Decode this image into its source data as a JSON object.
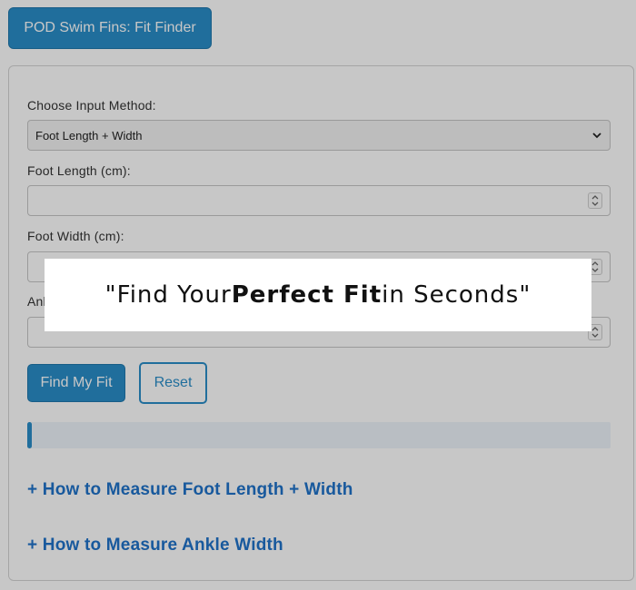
{
  "header": {
    "title": "POD Swim Fins: Fit Finder"
  },
  "form": {
    "method_label": "Choose Input Method:",
    "method_value": "Foot Length + Width",
    "length_label": "Foot Length (cm):",
    "width_label": "Foot Width (cm):",
    "ankle_label_visible": "Ank"
  },
  "buttons": {
    "find": "Find My Fit",
    "reset": "Reset"
  },
  "accordions": [
    "+ How to Measure Foot Length + Width",
    "+ How to Measure Ankle Width"
  ],
  "banner": {
    "open_quote": "\"",
    "part1": "Find Your ",
    "bold": "Perfect Fit",
    "part2": " in Seconds",
    "close_quote": "\""
  },
  "icons": {
    "select_chevron": "chevron-down-icon",
    "spinner": "spinner-arrows-icon"
  },
  "colors": {
    "accent": "#2a8dc8",
    "link": "#1f72c9",
    "result_bg": "#eef4fa"
  }
}
